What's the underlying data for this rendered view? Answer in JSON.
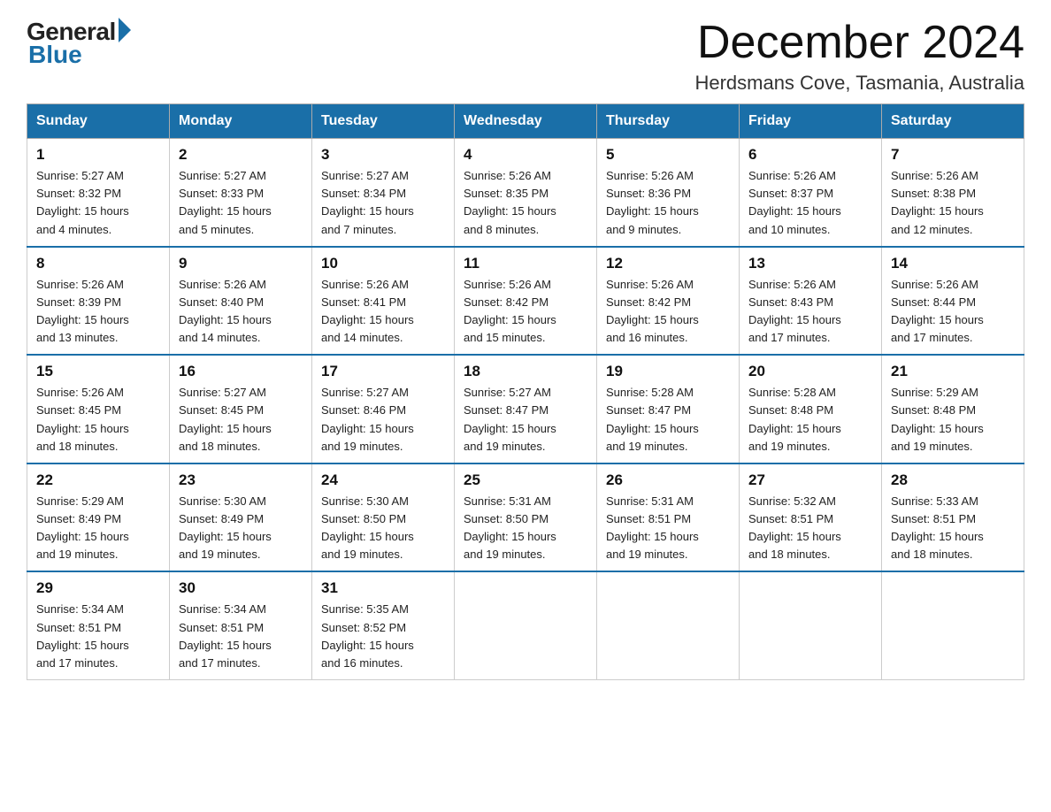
{
  "header": {
    "logo_general": "General",
    "logo_blue": "Blue",
    "month_title": "December 2024",
    "location": "Herdsmans Cove, Tasmania, Australia"
  },
  "weekdays": [
    "Sunday",
    "Monday",
    "Tuesday",
    "Wednesday",
    "Thursday",
    "Friday",
    "Saturday"
  ],
  "weeks": [
    [
      {
        "day": "1",
        "sunrise": "5:27 AM",
        "sunset": "8:32 PM",
        "daylight": "15 hours and 4 minutes."
      },
      {
        "day": "2",
        "sunrise": "5:27 AM",
        "sunset": "8:33 PM",
        "daylight": "15 hours and 5 minutes."
      },
      {
        "day": "3",
        "sunrise": "5:27 AM",
        "sunset": "8:34 PM",
        "daylight": "15 hours and 7 minutes."
      },
      {
        "day": "4",
        "sunrise": "5:26 AM",
        "sunset": "8:35 PM",
        "daylight": "15 hours and 8 minutes."
      },
      {
        "day": "5",
        "sunrise": "5:26 AM",
        "sunset": "8:36 PM",
        "daylight": "15 hours and 9 minutes."
      },
      {
        "day": "6",
        "sunrise": "5:26 AM",
        "sunset": "8:37 PM",
        "daylight": "15 hours and 10 minutes."
      },
      {
        "day": "7",
        "sunrise": "5:26 AM",
        "sunset": "8:38 PM",
        "daylight": "15 hours and 12 minutes."
      }
    ],
    [
      {
        "day": "8",
        "sunrise": "5:26 AM",
        "sunset": "8:39 PM",
        "daylight": "15 hours and 13 minutes."
      },
      {
        "day": "9",
        "sunrise": "5:26 AM",
        "sunset": "8:40 PM",
        "daylight": "15 hours and 14 minutes."
      },
      {
        "day": "10",
        "sunrise": "5:26 AM",
        "sunset": "8:41 PM",
        "daylight": "15 hours and 14 minutes."
      },
      {
        "day": "11",
        "sunrise": "5:26 AM",
        "sunset": "8:42 PM",
        "daylight": "15 hours and 15 minutes."
      },
      {
        "day": "12",
        "sunrise": "5:26 AM",
        "sunset": "8:42 PM",
        "daylight": "15 hours and 16 minutes."
      },
      {
        "day": "13",
        "sunrise": "5:26 AM",
        "sunset": "8:43 PM",
        "daylight": "15 hours and 17 minutes."
      },
      {
        "day": "14",
        "sunrise": "5:26 AM",
        "sunset": "8:44 PM",
        "daylight": "15 hours and 17 minutes."
      }
    ],
    [
      {
        "day": "15",
        "sunrise": "5:26 AM",
        "sunset": "8:45 PM",
        "daylight": "15 hours and 18 minutes."
      },
      {
        "day": "16",
        "sunrise": "5:27 AM",
        "sunset": "8:45 PM",
        "daylight": "15 hours and 18 minutes."
      },
      {
        "day": "17",
        "sunrise": "5:27 AM",
        "sunset": "8:46 PM",
        "daylight": "15 hours and 19 minutes."
      },
      {
        "day": "18",
        "sunrise": "5:27 AM",
        "sunset": "8:47 PM",
        "daylight": "15 hours and 19 minutes."
      },
      {
        "day": "19",
        "sunrise": "5:28 AM",
        "sunset": "8:47 PM",
        "daylight": "15 hours and 19 minutes."
      },
      {
        "day": "20",
        "sunrise": "5:28 AM",
        "sunset": "8:48 PM",
        "daylight": "15 hours and 19 minutes."
      },
      {
        "day": "21",
        "sunrise": "5:29 AM",
        "sunset": "8:48 PM",
        "daylight": "15 hours and 19 minutes."
      }
    ],
    [
      {
        "day": "22",
        "sunrise": "5:29 AM",
        "sunset": "8:49 PM",
        "daylight": "15 hours and 19 minutes."
      },
      {
        "day": "23",
        "sunrise": "5:30 AM",
        "sunset": "8:49 PM",
        "daylight": "15 hours and 19 minutes."
      },
      {
        "day": "24",
        "sunrise": "5:30 AM",
        "sunset": "8:50 PM",
        "daylight": "15 hours and 19 minutes."
      },
      {
        "day": "25",
        "sunrise": "5:31 AM",
        "sunset": "8:50 PM",
        "daylight": "15 hours and 19 minutes."
      },
      {
        "day": "26",
        "sunrise": "5:31 AM",
        "sunset": "8:51 PM",
        "daylight": "15 hours and 19 minutes."
      },
      {
        "day": "27",
        "sunrise": "5:32 AM",
        "sunset": "8:51 PM",
        "daylight": "15 hours and 18 minutes."
      },
      {
        "day": "28",
        "sunrise": "5:33 AM",
        "sunset": "8:51 PM",
        "daylight": "15 hours and 18 minutes."
      }
    ],
    [
      {
        "day": "29",
        "sunrise": "5:34 AM",
        "sunset": "8:51 PM",
        "daylight": "15 hours and 17 minutes."
      },
      {
        "day": "30",
        "sunrise": "5:34 AM",
        "sunset": "8:51 PM",
        "daylight": "15 hours and 17 minutes."
      },
      {
        "day": "31",
        "sunrise": "5:35 AM",
        "sunset": "8:52 PM",
        "daylight": "15 hours and 16 minutes."
      },
      null,
      null,
      null,
      null
    ]
  ],
  "labels": {
    "sunrise": "Sunrise:",
    "sunset": "Sunset:",
    "daylight": "Daylight:"
  }
}
